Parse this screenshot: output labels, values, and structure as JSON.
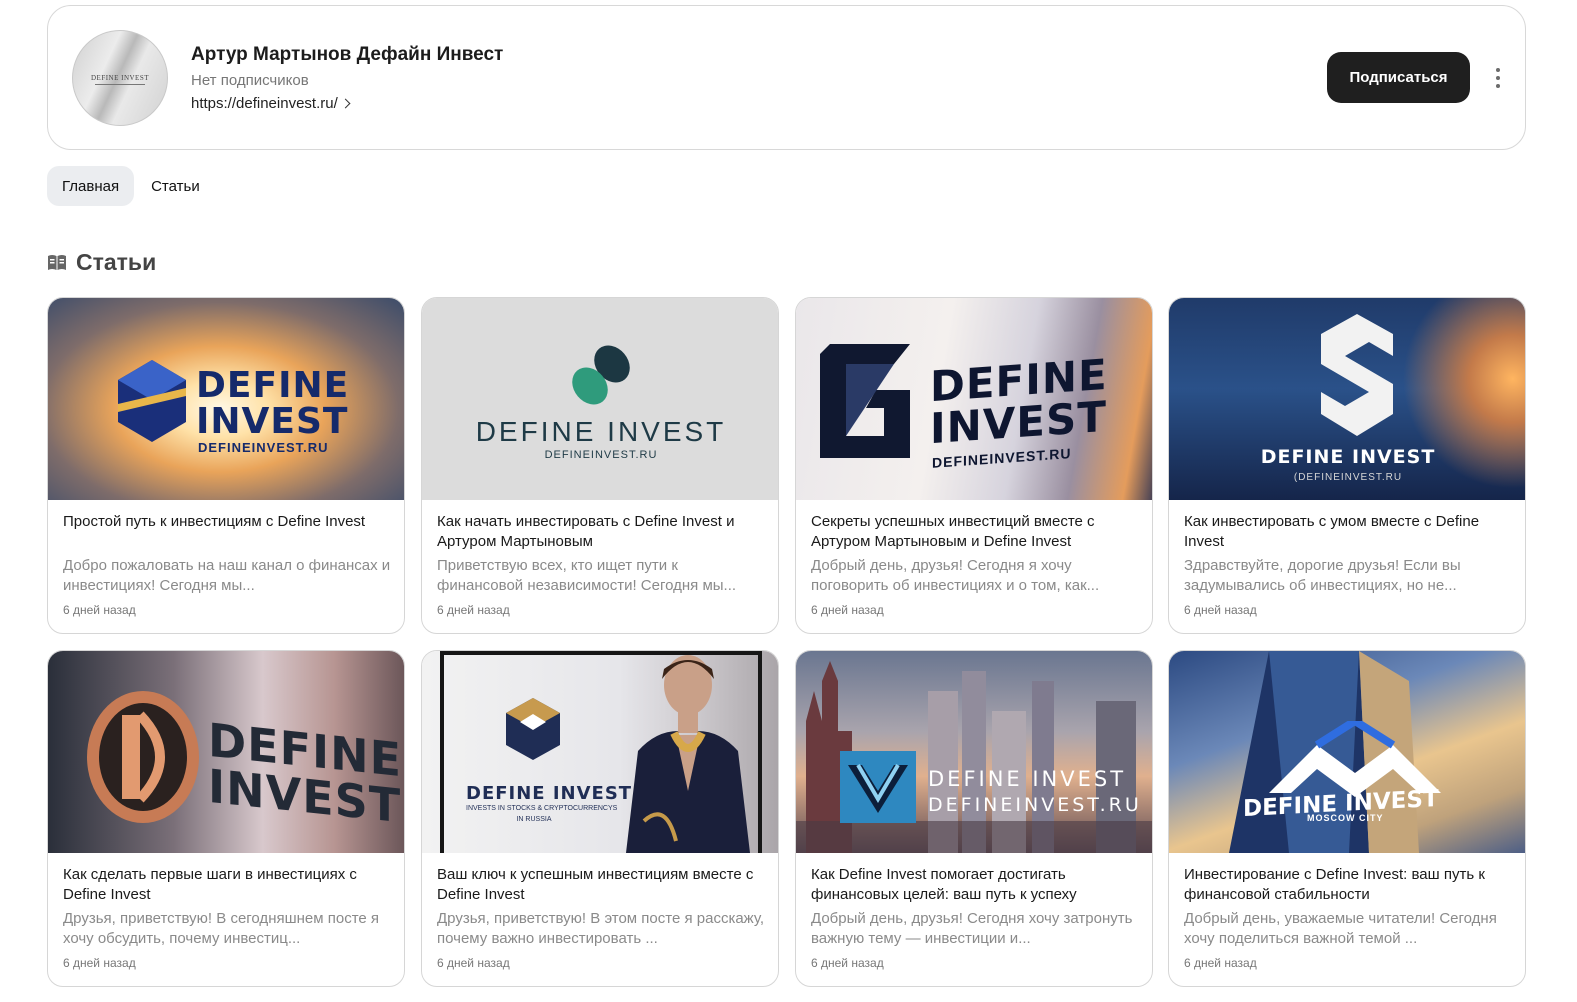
{
  "channel": {
    "name": "Артур Мартынов Дефайн Инвест",
    "subscribers": "Нет подписчиков",
    "link": "https://defineinvest.ru/",
    "avatar_text": "DEFINE INVEST",
    "subscribe_label": "Подписаться"
  },
  "tabs": [
    {
      "label": "Главная",
      "active": true
    },
    {
      "label": "Статьи",
      "active": false
    }
  ],
  "section": {
    "title": "Статьи",
    "icon": "book-icon"
  },
  "articles": [
    {
      "logo_main": "DEFINE\nINVEST",
      "logo_sub": "DEFINEINVEST.RU",
      "title": "Простой путь к инвестициям с Define Invest",
      "snippet": "Добро пожаловать на наш канал о финансах и инвестициях! Сегодня мы...",
      "date": "6 дней назад"
    },
    {
      "logo_main": "DEFINE INVEST",
      "logo_sub": "DEFINEINVEST.RU",
      "title": "Как начать инвестировать с Define Invest и Артуром Мартыновым",
      "snippet": "Приветствую всех, кто ищет пути к финансовой независимости! Сегодня мы...",
      "date": "6 дней назад"
    },
    {
      "logo_main": "DEFINE\nINVEST",
      "logo_sub": "DEFINEINVEST.RU",
      "title": "Секреты успешных инвестиций вместе с Артуром Мартыновым и Define Invest",
      "snippet": "Добрый день, друзья! Сегодня я хочу поговорить об инвестициях и о том, как...",
      "date": "6 дней назад"
    },
    {
      "logo_main": "DEFINE INVEST",
      "logo_sub": "(DEFINEINVEST.RU",
      "title": "Как инвестировать с умом вместе с Define Invest",
      "snippet": "Здравствуйте, дорогие друзья! Если вы задумывались об инвестициях, но не...",
      "date": "6 дней назад"
    },
    {
      "logo_main": "DEFINE\nINVEST",
      "logo_sub": "",
      "title": "Как сделать первые шаги в инвестициях с Define Invest",
      "snippet": "Друзья, приветствую! В сегодняшнем посте я хочу обсудить, почему инвестиц...",
      "date": "6 дней назад"
    },
    {
      "logo_main": "DEFINE INVEST",
      "logo_sub": "INVESTS IN STOCKS & CRYPTOCURRENCYS\nIN RUSSIA",
      "title": "Ваш ключ к успешным инвестициям вместе с Define Invest",
      "snippet": "Друзья, приветствую! В этом посте я расскажу, почему важно инвестировать ...",
      "date": "6 дней назад"
    },
    {
      "logo_main": "DEFINE INVEST",
      "logo_sub": "DEFINEINVEST.RU",
      "title": "Как Define Invest помогает достигать финансовых целей: ваш путь к успеху",
      "snippet": "Добрый день, друзья! Сегодня хочу затронуть важную тему — инвестиции и...",
      "date": "6 дней назад"
    },
    {
      "logo_main": "DEFINE INVEST",
      "logo_sub": "MOSCOW CITY",
      "title": "Инвестирование с Define Invest: ваш путь к финансовой стабильности",
      "snippet": "Добрый день, уважаемые читатели! Сегодня хочу поделиться важной темой ...",
      "date": "6 дней назад"
    }
  ]
}
